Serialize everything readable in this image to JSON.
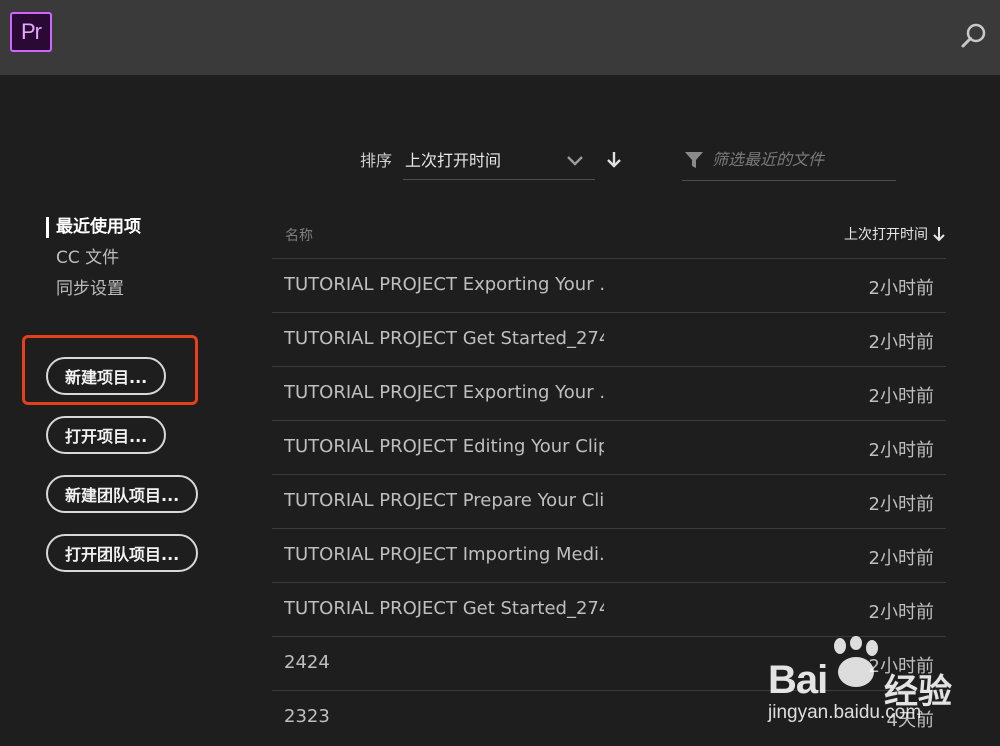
{
  "app": {
    "logo_text": "Pr"
  },
  "toolbar": {
    "search_icon": "search-icon"
  },
  "sort": {
    "label": "排序",
    "selected": "上次打开时间",
    "direction_icon": "arrow-down-icon"
  },
  "filter": {
    "placeholder": "筛选最近的文件",
    "icon": "funnel-icon"
  },
  "nav": {
    "items": [
      {
        "label": "最近使用项",
        "active": true
      },
      {
        "label": "CC 文件",
        "active": false
      },
      {
        "label": "同步设置",
        "active": false
      }
    ]
  },
  "actions": {
    "new_project": "新建项目...",
    "open_project": "打开项目...",
    "new_team_project": "新建团队项目...",
    "open_team_project": "打开团队项目..."
  },
  "table": {
    "col_name": "名称",
    "col_time": "上次打开时间",
    "rows": [
      {
        "name": "TUTORIAL PROJECT Exporting Your ...",
        "time": "2小时前"
      },
      {
        "name": "TUTORIAL PROJECT Get Started_274...",
        "time": "2小时前"
      },
      {
        "name": "TUTORIAL PROJECT Exporting Your ...",
        "time": "2小时前"
      },
      {
        "name": "TUTORIAL PROJECT Editing Your Clip...",
        "time": "2小时前"
      },
      {
        "name": "TUTORIAL PROJECT Prepare Your Cli...",
        "time": "2小时前"
      },
      {
        "name": "TUTORIAL PROJECT Importing Medi...",
        "time": "2小时前"
      },
      {
        "name": "TUTORIAL PROJECT Get Started_274...",
        "time": "2小时前"
      },
      {
        "name": "2424",
        "time": "2小时前"
      },
      {
        "name": "2323",
        "time": "4天前"
      }
    ]
  },
  "watermark": {
    "brand": "Bai",
    "brand_suffix": "经验",
    "url": "jingyan.baidu.com"
  },
  "colors": {
    "highlight": "#e4401c",
    "logo_border": "#cc66ff",
    "background": "#1e1e1e",
    "topbar": "#3a3a3a"
  }
}
